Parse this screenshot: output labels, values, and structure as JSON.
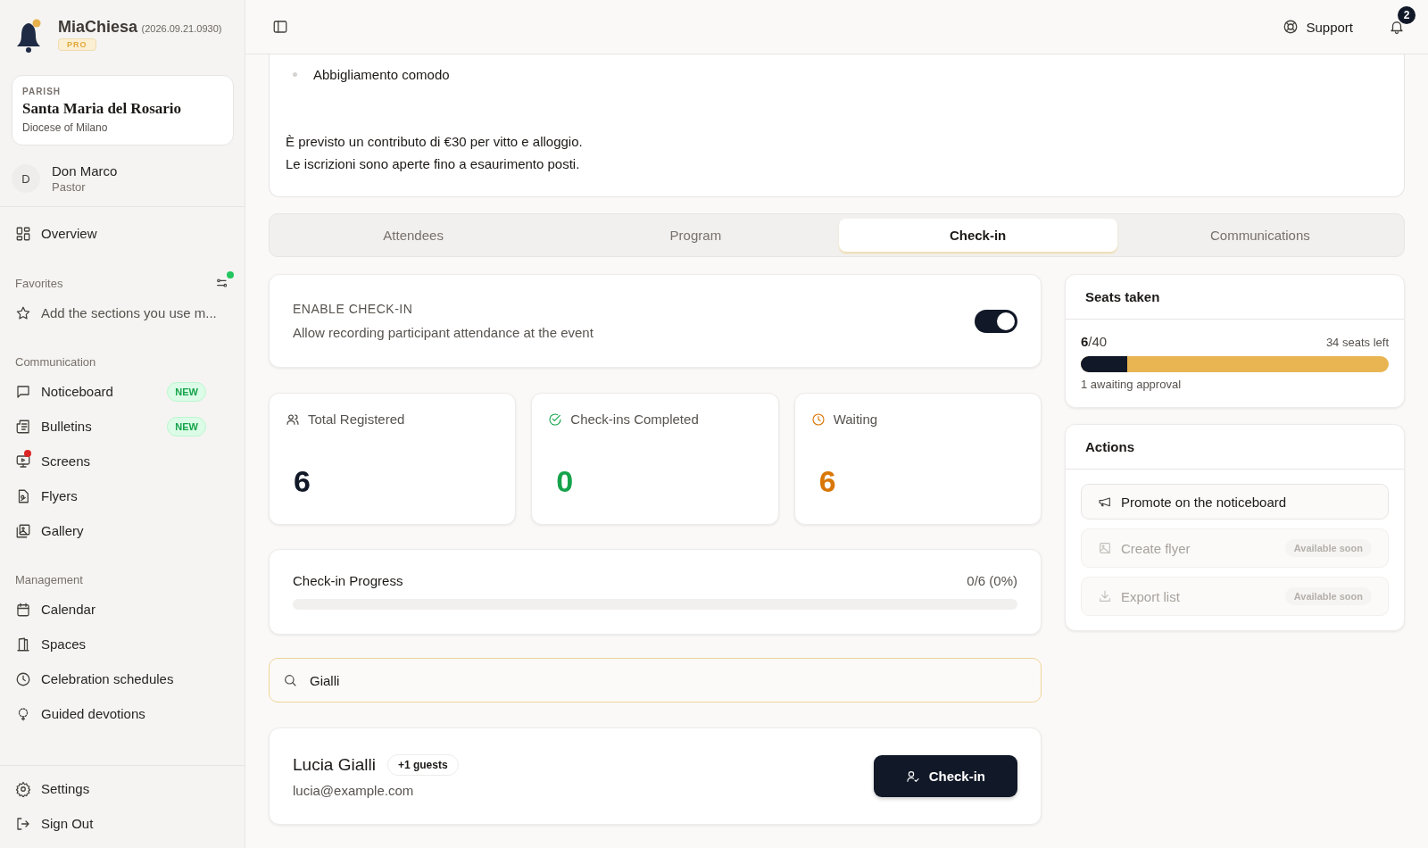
{
  "app": {
    "name": "MiaChiesa",
    "version": "(2026.09.21.0930)",
    "plan": "PRO"
  },
  "parish": {
    "label": "PARISH",
    "name": "Santa Maria del Rosario",
    "diocese": "Diocese of Milano"
  },
  "user": {
    "initial": "D",
    "name": "Don Marco",
    "role": "Pastor"
  },
  "overview": {
    "label": "Overview"
  },
  "favorites": {
    "title": "Favorites",
    "alert": true,
    "hint": "Add the sections you use m..."
  },
  "sections": [
    {
      "title": "Communication",
      "items": [
        {
          "label": "Noticeboard",
          "badge": "NEW",
          "alert": false
        },
        {
          "label": "Bulletins",
          "badge": "NEW",
          "alert": false
        },
        {
          "label": "Screens",
          "alert": true
        },
        {
          "label": "Flyers",
          "alert": false
        },
        {
          "label": "Gallery",
          "alert": false
        }
      ]
    },
    {
      "title": "Management",
      "items": [
        {
          "label": "Calendar",
          "alert": false
        },
        {
          "label": "Spaces",
          "alert": false
        },
        {
          "label": "Celebration schedules",
          "alert": false
        },
        {
          "label": "Guided devotions",
          "alert": false
        }
      ]
    }
  ],
  "footer_items": [
    {
      "label": "Settings"
    },
    {
      "label": "Sign Out"
    }
  ],
  "header": {
    "support": "Support",
    "notifications": "2"
  },
  "description": {
    "list": [
      "Abbigliamento comodo"
    ],
    "paragraphs": [
      "È previsto un contributo di €30 per vitto e alloggio.",
      "Le iscrizioni sono aperte fino a esaurimento posti."
    ]
  },
  "tabs": [
    {
      "label": "Attendees",
      "selected": false
    },
    {
      "label": "Program",
      "selected": false
    },
    {
      "label": "Check-in",
      "selected": true
    },
    {
      "label": "Communications",
      "selected": false
    }
  ],
  "checkin_toggle": {
    "title": "ENABLE CHECK-IN",
    "description": "Allow recording participant attendance at the event",
    "on": true
  },
  "stats": [
    {
      "kind": "total",
      "label": "Total Registered",
      "value": "6",
      "color": "#111827"
    },
    {
      "kind": "completed",
      "label": "Check-ins Completed",
      "value": "0",
      "color": "#16a34a"
    },
    {
      "kind": "waiting",
      "label": "Waiting",
      "value": "6",
      "color": "#d97706"
    }
  ],
  "progress": {
    "title": "Check-in Progress",
    "reading": "0/6 (0%)",
    "level": 0
  },
  "search": {
    "value": "Gialli"
  },
  "results": [
    {
      "name": "Lucia Gialli",
      "guests": "+1 guests",
      "email": "lucia@example.com",
      "button": "Check-in"
    }
  ],
  "seats": {
    "title": "Seats taken",
    "taken": "6",
    "total": "/40",
    "left": "34 seats left",
    "level": 0.15,
    "note": "1 awaiting approval"
  },
  "actions": {
    "title": "Actions",
    "items": [
      {
        "kind": "promote",
        "label": "Promote on the noticeboard",
        "disabled": false
      },
      {
        "kind": "flyer",
        "label": "Create flyer",
        "badge": "Available soon",
        "disabled": true
      },
      {
        "kind": "export",
        "label": "Export list",
        "badge": "Available soon",
        "disabled": true
      }
    ]
  }
}
